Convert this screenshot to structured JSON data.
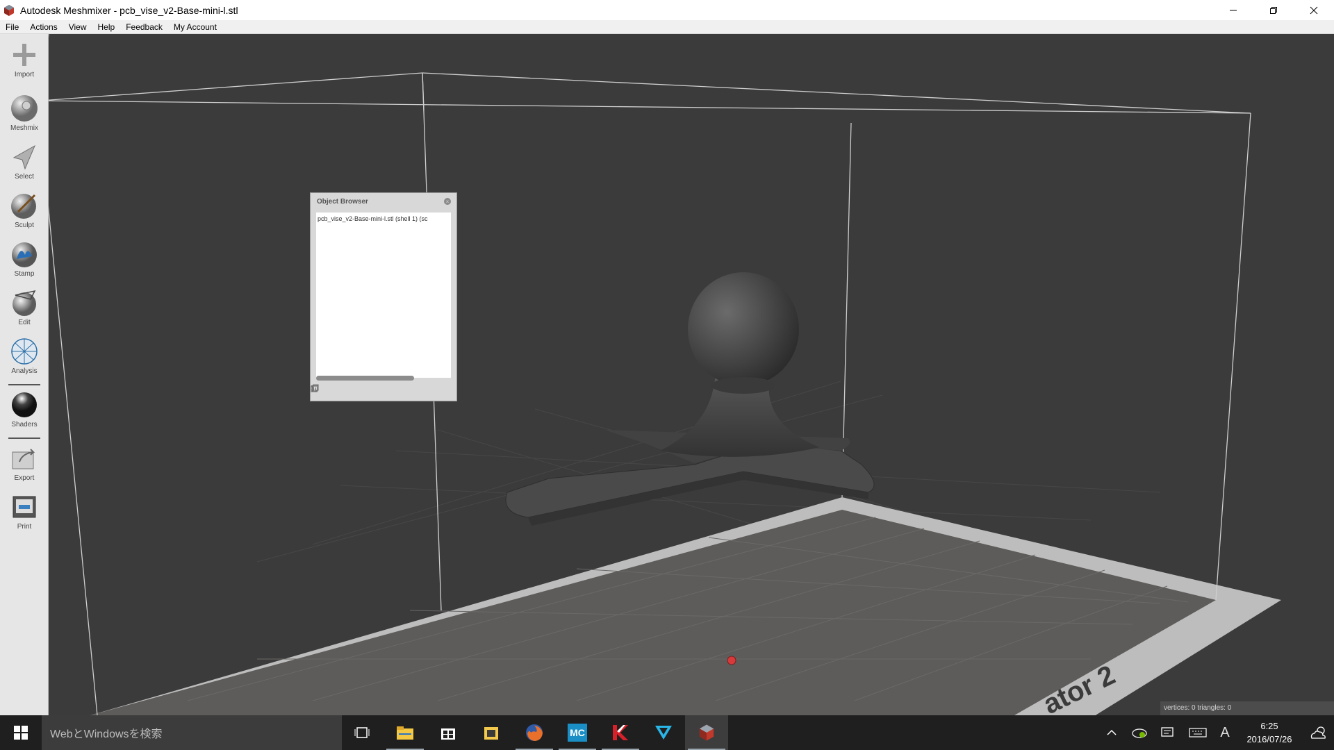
{
  "window": {
    "title": "Autodesk Meshmixer - pcb_vise_v2-Base-mini-l.stl",
    "minimize_icon": "minimize-icon",
    "maximize_icon": "restore-icon",
    "close_icon": "close-icon"
  },
  "menu": [
    "File",
    "Actions",
    "View",
    "Help",
    "Feedback",
    "My Account"
  ],
  "tools": [
    {
      "label": "Import",
      "icon": "import-icon"
    },
    {
      "label": "Meshmix",
      "icon": "meshmix-icon"
    },
    {
      "label": "Select",
      "icon": "select-icon"
    },
    {
      "label": "Sculpt",
      "icon": "sculpt-icon"
    },
    {
      "label": "Stamp",
      "icon": "stamp-icon"
    },
    {
      "label": "Edit",
      "icon": "edit-icon"
    },
    {
      "label": "Analysis",
      "icon": "analysis-icon"
    },
    {
      "label": "Shaders",
      "icon": "shaders-icon"
    },
    {
      "label": "Export",
      "icon": "export-icon"
    },
    {
      "label": "Print",
      "icon": "print-icon"
    }
  ],
  "object_browser": {
    "title": "Object Browser",
    "items": [
      "pcb_vise_v2-Base-mini-l.stl (shell 1) (sc"
    ]
  },
  "viewport": {
    "bed_label": "ator 2",
    "stats": "vertices: 0 triangles: 0",
    "colors": {
      "background": "#3b3b3b",
      "bed": "#5e5c5a",
      "bed_border": "#bdbdbd",
      "model": "#4a4a4a"
    }
  },
  "taskbar": {
    "search_placeholder": "WebとWindowsを検索",
    "apps": [
      "task-view-icon",
      "file-explorer-icon",
      "store-icon",
      "folder-app-icon",
      "firefox-icon",
      "mc-app-icon",
      "k-app-icon",
      "v-app-icon",
      "meshmixer-icon"
    ],
    "mc_label": "MC",
    "ime": "A",
    "time": "6:25",
    "date": "2016/07/26"
  }
}
